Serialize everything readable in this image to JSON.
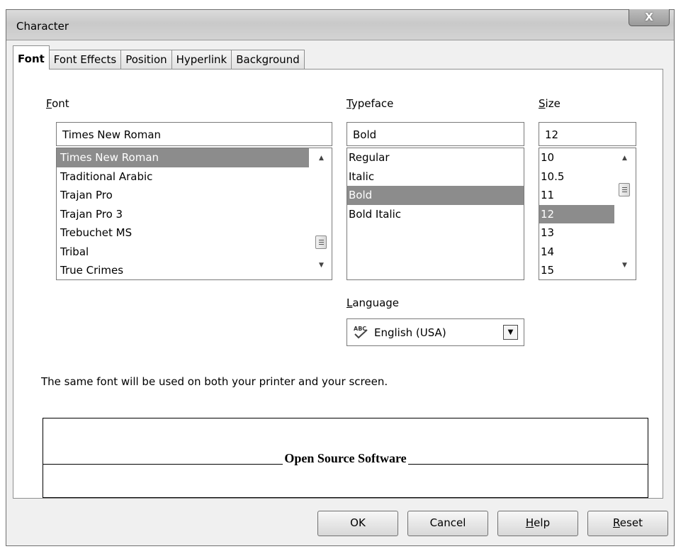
{
  "window": {
    "title": "Character",
    "close_glyph": "X"
  },
  "tabs": [
    {
      "label": "Font",
      "active": true
    },
    {
      "label": "Font Effects",
      "active": false
    },
    {
      "label": "Position",
      "active": false
    },
    {
      "label": "Hyperlink",
      "active": false
    },
    {
      "label": "Background",
      "active": false
    }
  ],
  "font": {
    "label_mnemonic": "F",
    "label_rest": "ont",
    "value": "Times New Roman",
    "list": [
      "Times New Roman",
      "Traditional Arabic",
      "Trajan Pro",
      "Trajan Pro 3",
      "Trebuchet MS",
      "Tribal",
      "True Crimes"
    ],
    "selected": "Times New Roman"
  },
  "typeface": {
    "label_mnemonic": "T",
    "label_rest": "ypeface",
    "value": "Bold",
    "list": [
      "Regular",
      "Italic",
      "Bold",
      "Bold Italic"
    ],
    "selected": "Bold"
  },
  "size": {
    "label_mnemonic": "S",
    "label_rest": "ize",
    "value": "12",
    "list": [
      "10",
      "10.5",
      "11",
      "12",
      "13",
      "14",
      "15"
    ],
    "selected": "12"
  },
  "language": {
    "label_mnemonic": "L",
    "label_rest": "anguage",
    "value": "English (USA)",
    "icon": "spellcheck-abc-icon"
  },
  "info_text": "The same font will be used on both your printer and your screen.",
  "preview_text": "Open Source Software",
  "buttons": {
    "ok": "OK",
    "cancel": "Cancel",
    "help_mnemonic": "H",
    "help_rest": "elp",
    "reset_mnemonic": "R",
    "reset_rest": "eset"
  },
  "colors": {
    "selection": "#8c8c8c",
    "tab_border": "#8e8f8f"
  }
}
